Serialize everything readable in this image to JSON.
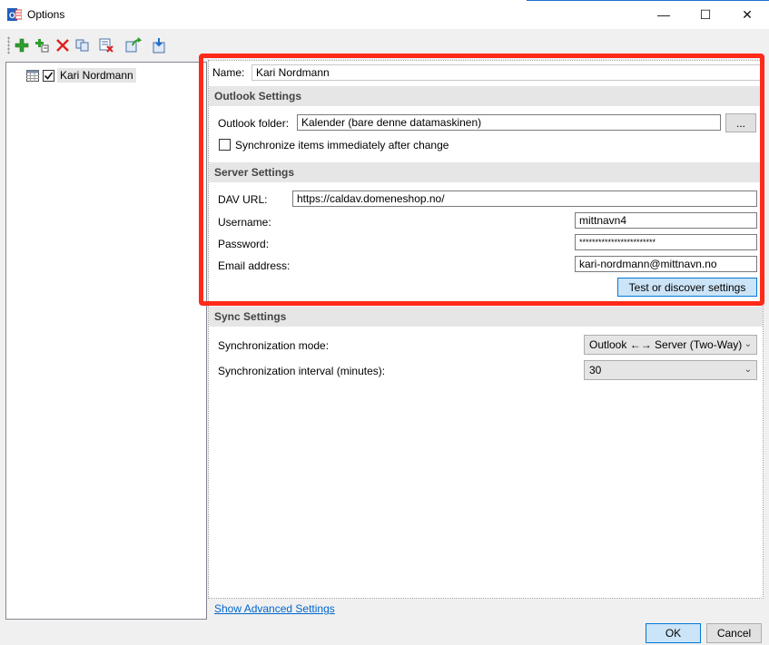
{
  "window": {
    "title": "Options",
    "minimize": "—",
    "maximize": "☐",
    "close": "✕"
  },
  "toolbar": {
    "buttons": [
      "add-icon",
      "add-multiple-icon",
      "delete-icon",
      "copy-icon",
      "clear-cache-icon",
      "export-icon",
      "import-icon"
    ]
  },
  "tree": {
    "items": [
      {
        "label": "Kari Nordmann",
        "checked": true
      }
    ]
  },
  "profile": {
    "name_label": "Name:",
    "name_value": "Kari Nordmann"
  },
  "outlook": {
    "heading": "Outlook Settings",
    "folder_label": "Outlook folder:",
    "folder_value": "Kalender (bare denne datamaskinen)",
    "browse_label": "...",
    "sync_immediately_label": "Synchronize items immediately after change"
  },
  "server": {
    "heading": "Server Settings",
    "dav_url_label": "DAV URL:",
    "dav_url_value": "https://caldav.domeneshop.no/",
    "username_label": "Username:",
    "username_value": "mittnavn4",
    "password_label": "Password:",
    "password_value": "************************",
    "email_label": "Email address:",
    "email_value": "kari-nordmann@mittnavn.no",
    "test_button": "Test or discover settings"
  },
  "sync": {
    "heading": "Sync Settings",
    "mode_label": "Synchronization mode:",
    "mode_value": "Outlook ←→ Server (Two-Way)",
    "interval_label": "Synchronization interval (minutes):",
    "interval_value": "30"
  },
  "footer": {
    "advanced_link": "Show Advanced Settings",
    "ok": "OK",
    "cancel": "Cancel"
  },
  "colors": {
    "highlight": "#ff2a1a",
    "link": "#0066cc",
    "button_focus": "#cce4f7"
  }
}
